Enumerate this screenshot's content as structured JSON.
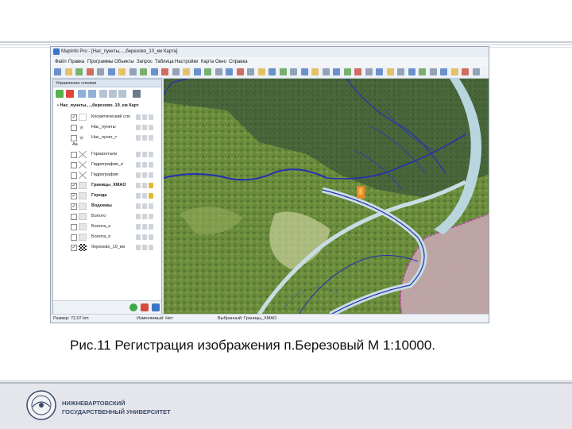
{
  "app": {
    "title": "MapInfo Pro - [Нас_пункты,...,березово_10_км Карта]",
    "menus": [
      "Файл",
      "Правка",
      "Программы",
      "Объекты",
      "Запрос",
      "Таблица",
      "Настройки",
      "Карта",
      "Окно",
      "Справка"
    ]
  },
  "layer_panel": {
    "title": "Управление слоями",
    "root_label": "Нас_пункты,...,березово_10_км Карт",
    "layers": [
      {
        "label": "Косметический сло",
        "checked": true,
        "bold": false
      },
      {
        "label": "Нас_пункты",
        "checked": false,
        "bold": false
      },
      {
        "label": "Нас_пункт_т",
        "checked": false,
        "bold": false,
        "sublabel": "Aa"
      },
      {
        "label": "Горизонтали",
        "checked": false,
        "bold": false
      },
      {
        "label": "Гидрография_п",
        "checked": false,
        "bold": false
      },
      {
        "label": "Гидрография",
        "checked": false,
        "bold": false
      },
      {
        "label": "Границы_ХМАО",
        "checked": true,
        "bold": true
      },
      {
        "label": "Города",
        "checked": true,
        "bold": true
      },
      {
        "label": "Водоемы",
        "checked": true,
        "bold": true
      },
      {
        "label": "Болото",
        "checked": false,
        "bold": false
      },
      {
        "label": "Болота_н",
        "checked": false,
        "bold": false
      },
      {
        "label": "Болота_п",
        "checked": false,
        "bold": false
      },
      {
        "label": "березово_10_км",
        "checked": true,
        "bold": false
      }
    ]
  },
  "status": {
    "scale": "Размер: 72,07 km",
    "editable": "Изменяемый: Нет",
    "selected": "Выбранный: Границы_ХМАО"
  },
  "caption": "Рис.11 Регистрация изображения п.Березовый М 1:10000.",
  "footer": {
    "line1": "НИЖНЕВАРТОВСКИЙ",
    "line2": "ГОСУДАРСТВЕННЫЙ УНИВЕРСИТЕТ"
  },
  "colors": {
    "accent": "#3a74c9",
    "map_green": "#5a7d3a",
    "river_blue": "#1f2fb0",
    "border_magenta": "#c33fae",
    "footer_bg": "#e4e6ec"
  }
}
